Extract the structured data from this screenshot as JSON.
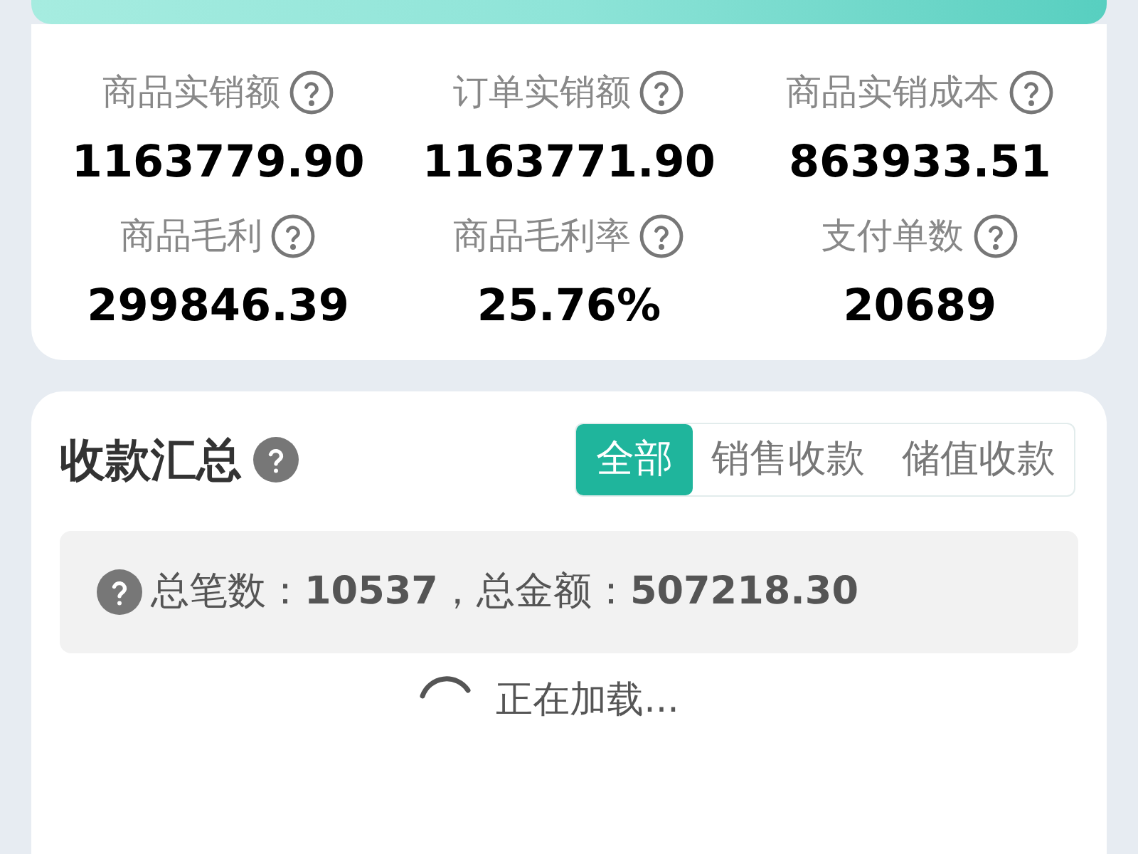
{
  "metrics": [
    {
      "label": "商品实销额",
      "value": "1163779.90"
    },
    {
      "label": "订单实销额",
      "value": "1163771.90"
    },
    {
      "label": "商品实销成本",
      "value": "863933.51"
    },
    {
      "label": "商品毛利",
      "value": "299846.39"
    },
    {
      "label": "商品毛利率",
      "value": "25.76%"
    },
    {
      "label": "支付单数",
      "value": "20689"
    }
  ],
  "collection": {
    "title": "收款汇总",
    "tabs": [
      {
        "label": "全部",
        "selected": true
      },
      {
        "label": "销售收款",
        "selected": false
      },
      {
        "label": "储值收款",
        "selected": false
      }
    ],
    "summary": "总笔数：**10537**，总金额：**507218.30**",
    "loading": "正在加载..."
  }
}
